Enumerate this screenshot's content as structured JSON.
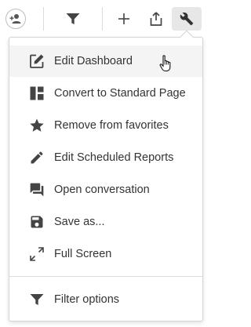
{
  "toolbar": {
    "buttons": [
      {
        "name": "share-user-button",
        "icon": "add-person-icon"
      },
      {
        "name": "filter-button",
        "icon": "filter-icon"
      },
      {
        "name": "add-button",
        "icon": "plus-icon"
      },
      {
        "name": "export-button",
        "icon": "share-export-icon"
      },
      {
        "name": "settings-wrench-button",
        "icon": "wrench-icon",
        "active": true
      }
    ]
  },
  "menu": {
    "items": [
      {
        "label": "Edit Dashboard",
        "icon": "edit-square-icon",
        "hovered": true
      },
      {
        "label": "Convert to Standard Page",
        "icon": "layout-icon"
      },
      {
        "label": "Remove from favorites",
        "icon": "star-icon"
      },
      {
        "label": "Edit Scheduled Reports",
        "icon": "pencil-icon"
      },
      {
        "label": "Open conversation",
        "icon": "chat-icon"
      },
      {
        "label": "Save as...",
        "icon": "save-icon"
      },
      {
        "label": "Full Screen",
        "icon": "fullscreen-icon"
      }
    ],
    "footer_items": [
      {
        "label": "Filter options",
        "icon": "filter-icon"
      }
    ]
  },
  "colors": {
    "icon": "#444444",
    "active_button_bg": "#e7e7e7",
    "hover_bg": "#f4f4f4"
  }
}
